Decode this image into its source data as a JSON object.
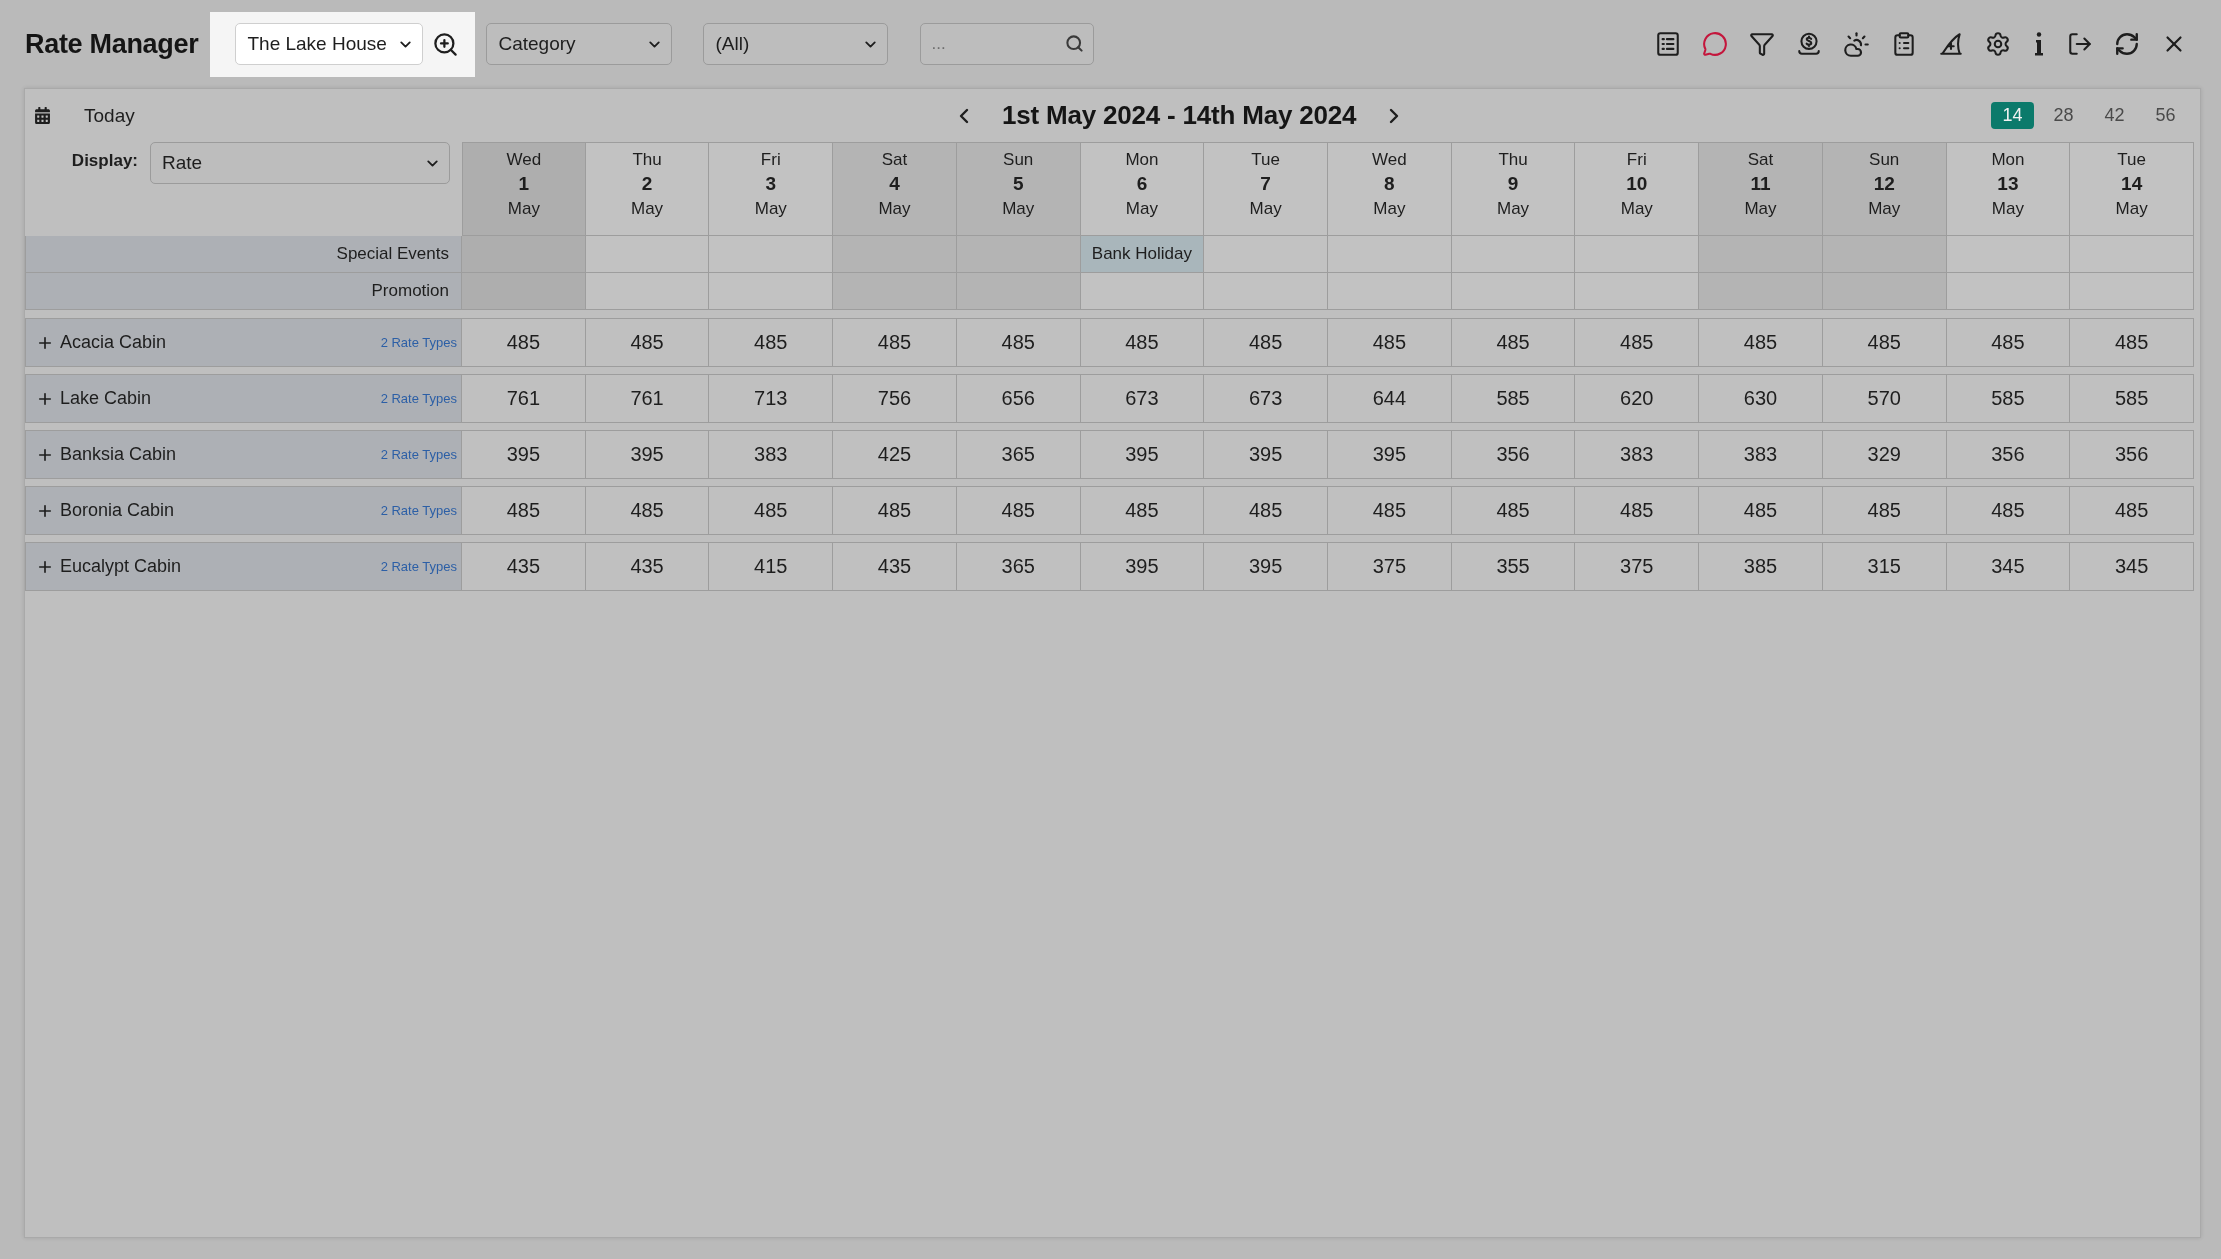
{
  "app": {
    "title": "Rate Manager"
  },
  "toolbar": {
    "property_select": {
      "value": "The Lake House",
      "highlighted": true
    },
    "filters": [
      {
        "value": "Category"
      },
      {
        "value": "(All)"
      }
    ],
    "search": {
      "placeholder": "..."
    }
  },
  "calendar": {
    "today": "Today",
    "range_title": "1st May 2024 - 14th May 2024",
    "spans": [
      {
        "label": "14",
        "selected": true
      },
      {
        "label": "28",
        "selected": false
      },
      {
        "label": "42",
        "selected": false
      },
      {
        "label": "56",
        "selected": false
      }
    ],
    "display": {
      "label": "Display:",
      "value": "Rate"
    }
  },
  "days": [
    {
      "weekday": "Wed",
      "date": "1",
      "month": "May",
      "today": true,
      "weekend": false
    },
    {
      "weekday": "Thu",
      "date": "2",
      "month": "May",
      "today": false,
      "weekend": false
    },
    {
      "weekday": "Fri",
      "date": "3",
      "month": "May",
      "today": false,
      "weekend": false
    },
    {
      "weekday": "Sat",
      "date": "4",
      "month": "May",
      "today": false,
      "weekend": true
    },
    {
      "weekday": "Sun",
      "date": "5",
      "month": "May",
      "today": false,
      "weekend": true
    },
    {
      "weekday": "Mon",
      "date": "6",
      "month": "May",
      "today": false,
      "weekend": false,
      "special_event": "Bank Holiday"
    },
    {
      "weekday": "Tue",
      "date": "7",
      "month": "May",
      "today": false,
      "weekend": false
    },
    {
      "weekday": "Wed",
      "date": "8",
      "month": "May",
      "today": false,
      "weekend": false
    },
    {
      "weekday": "Thu",
      "date": "9",
      "month": "May",
      "today": false,
      "weekend": false
    },
    {
      "weekday": "Fri",
      "date": "10",
      "month": "May",
      "today": false,
      "weekend": false
    },
    {
      "weekday": "Sat",
      "date": "11",
      "month": "May",
      "today": false,
      "weekend": true
    },
    {
      "weekday": "Sun",
      "date": "12",
      "month": "May",
      "today": false,
      "weekend": true
    },
    {
      "weekday": "Mon",
      "date": "13",
      "month": "May",
      "today": false,
      "weekend": false
    },
    {
      "weekday": "Tue",
      "date": "14",
      "month": "May",
      "today": false,
      "weekend": false
    }
  ],
  "info_rows": [
    {
      "kind": "special_events",
      "label": "Special Events"
    },
    {
      "kind": "promotion",
      "label": "Promotion"
    }
  ],
  "rooms": [
    {
      "name": "Acacia Cabin",
      "expanded": false,
      "rate_types": "2 Rate Types",
      "rates": [
        "485",
        "485",
        "485",
        "485",
        "485",
        "485",
        "485",
        "485",
        "485",
        "485",
        "485",
        "485",
        "485",
        "485"
      ]
    },
    {
      "name": "Lake Cabin",
      "expanded": false,
      "rate_types": "2 Rate Types",
      "rates": [
        "761",
        "761",
        "713",
        "756",
        "656",
        "673",
        "673",
        "644",
        "585",
        "620",
        "630",
        "570",
        "585",
        "585"
      ]
    },
    {
      "name": "Banksia Cabin",
      "expanded": false,
      "rate_types": "2 Rate Types",
      "rates": [
        "395",
        "395",
        "383",
        "425",
        "365",
        "395",
        "395",
        "395",
        "356",
        "383",
        "383",
        "329",
        "356",
        "356"
      ]
    },
    {
      "name": "Boronia Cabin",
      "expanded": false,
      "rate_types": "2 Rate Types",
      "rates": [
        "485",
        "485",
        "485",
        "485",
        "485",
        "485",
        "485",
        "485",
        "485",
        "485",
        "485",
        "485",
        "485",
        "485"
      ]
    },
    {
      "name": "Eucalypt Cabin",
      "expanded": false,
      "rate_types": "2 Rate Types",
      "rates": [
        "435",
        "435",
        "415",
        "435",
        "365",
        "395",
        "395",
        "375",
        "355",
        "375",
        "385",
        "315",
        "345",
        "345"
      ]
    }
  ]
}
